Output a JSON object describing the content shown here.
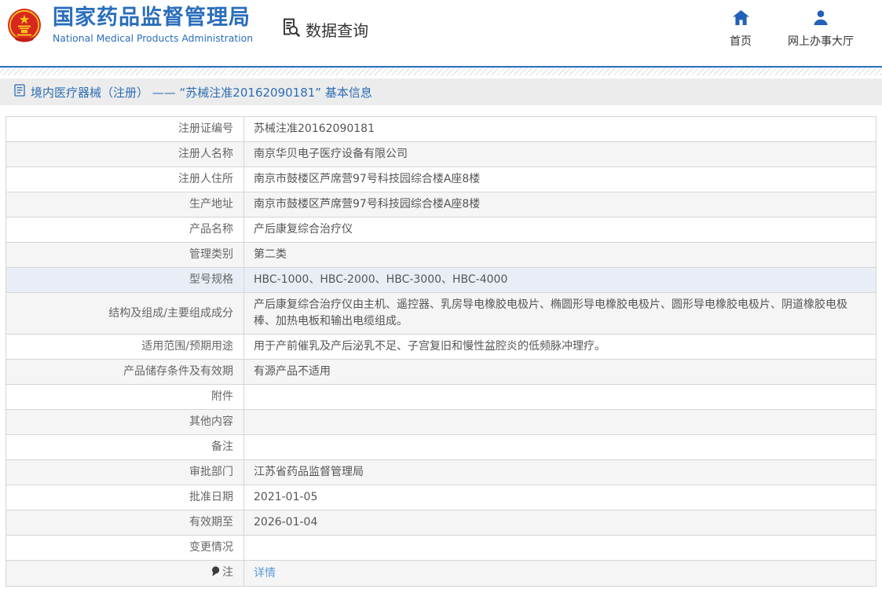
{
  "header": {
    "logo": {
      "title": "国家药品监督管理局",
      "subtitle": "National Medical Products Administration",
      "emblem_icon": "china-national-emblem"
    },
    "section": {
      "icon": "doc-search-icon",
      "label": "数据查询"
    },
    "nav": [
      {
        "icon": "home-icon",
        "label": "首页"
      },
      {
        "icon": "person-icon",
        "label": "网上办事大厅"
      }
    ]
  },
  "breadcrumb": {
    "icon": "document-icon",
    "text": "境内医疗器械（注册） —— “苏械注准20162090181” 基本信息"
  },
  "table": {
    "rows": [
      {
        "label": "注册证编号",
        "value": "苏械注准20162090181"
      },
      {
        "label": "注册人名称",
        "value": "南京华贝电子医疗设备有限公司"
      },
      {
        "label": "注册人住所",
        "value": "南京市鼓楼区芦席营97号科技园综合楼A座8楼"
      },
      {
        "label": "生产地址",
        "value": "南京市鼓楼区芦席营97号科技园综合楼A座8楼"
      },
      {
        "label": "产品名称",
        "value": "产后康复综合治疗仪"
      },
      {
        "label": "管理类别",
        "value": "第二类"
      },
      {
        "label": "型号规格",
        "value": "HBC-1000、HBC-2000、HBC-3000、HBC-4000",
        "highlighted": true
      },
      {
        "label": "结构及组成/主要组成成分",
        "value": "产后康复综合治疗仪由主机、遥控器、乳房导电橡胶电极片、椭圆形导电橡胶电极片、圆形导电橡胶电极片、阴道橡胶电极棒、加热电板和输出电缆组成。"
      },
      {
        "label": "适用范围/预期用途",
        "value": "用于产前催乳及产后泌乳不足、子宫复旧和慢性盆腔炎的低频脉冲理疗。"
      },
      {
        "label": "产品储存条件及有效期",
        "value": "有源产品不适用"
      },
      {
        "label": "附件",
        "value": ""
      },
      {
        "label": "其他内容",
        "value": ""
      },
      {
        "label": "备注",
        "value": ""
      },
      {
        "label": "审批部门",
        "value": "江苏省药品监督管理局"
      },
      {
        "label": "批准日期",
        "value": "2021-01-05"
      },
      {
        "label": "有效期至",
        "value": "2026-01-04"
      },
      {
        "label": "变更情况",
        "value": ""
      },
      {
        "label": "注",
        "value": "详情",
        "link": true,
        "label_icon": "balloon-icon"
      }
    ]
  },
  "colors": {
    "brand_blue": "#2a6ebb",
    "nav_icon_blue": "#2360b7",
    "link_blue": "#5b9bd5",
    "crumb_band_bg": "#ececec",
    "alt_row_bg": "#f5f5f6",
    "highlight_row_bg": "#e9eef6",
    "table_border": "#d5d5d5"
  }
}
